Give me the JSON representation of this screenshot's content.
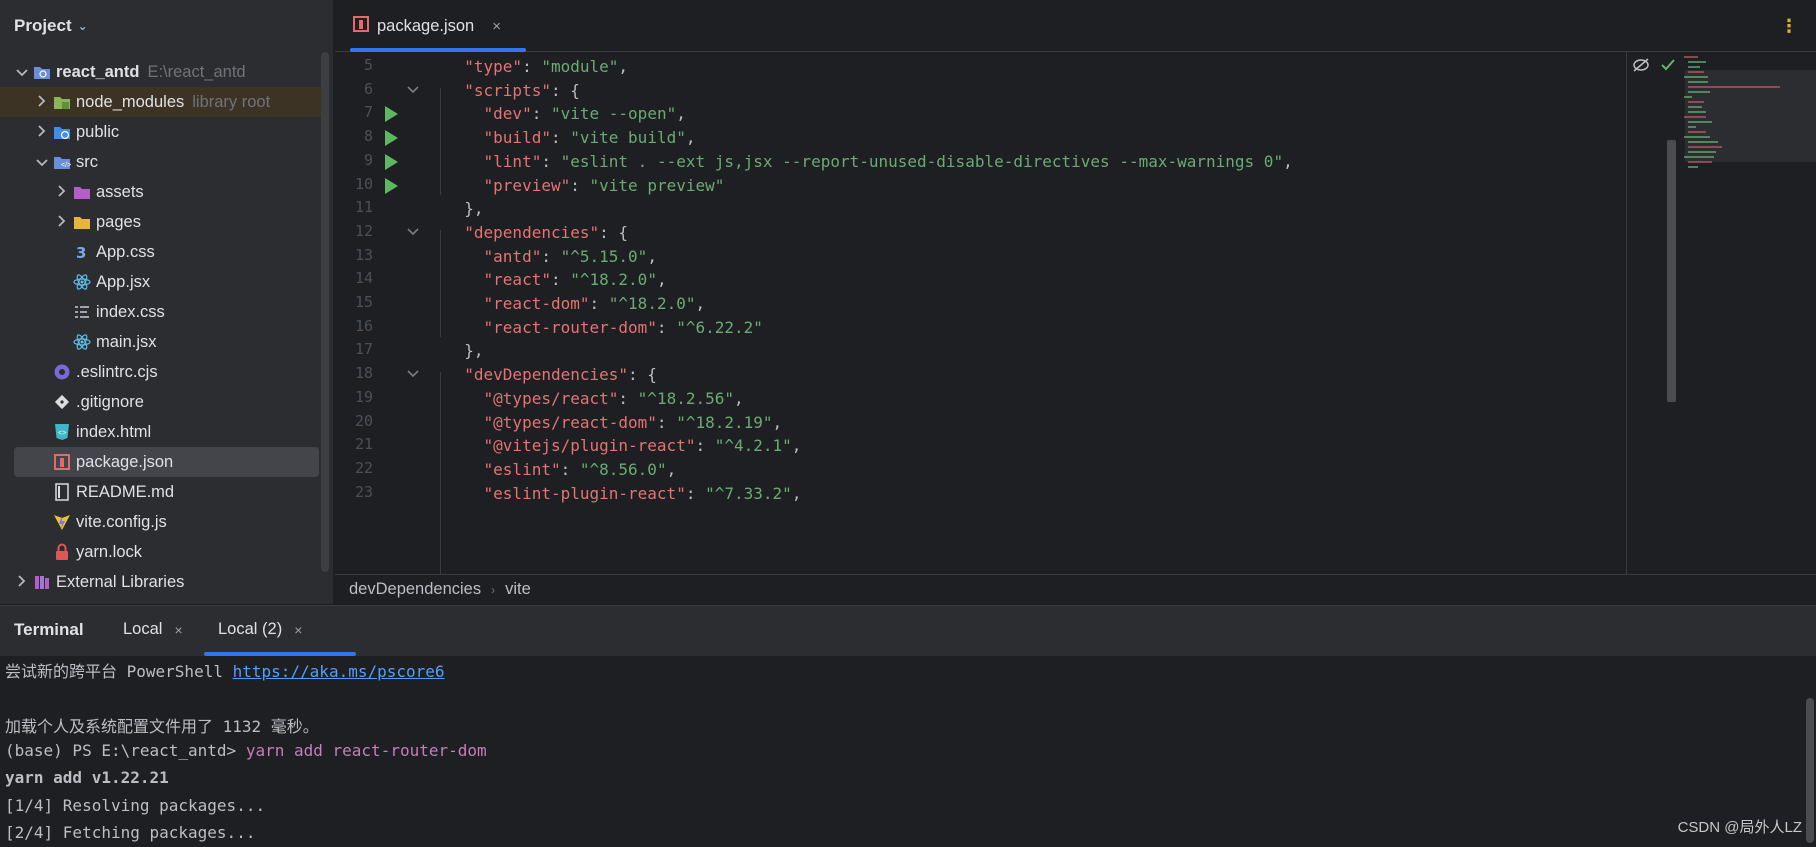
{
  "sidebar": {
    "title": "Project",
    "rows": [
      {
        "name": "react_antd",
        "hint": "E:\\react_antd",
        "arrow": "down",
        "icon": "project-module-icon",
        "depth": 0,
        "bold": true
      },
      {
        "name": "node_modules",
        "hint": "library root",
        "arrow": "right",
        "icon": "folder-node-icon",
        "depth": 1,
        "highlight": true
      },
      {
        "name": "public",
        "hint": "",
        "arrow": "right",
        "icon": "folder-web-icon",
        "depth": 1
      },
      {
        "name": "src",
        "hint": "",
        "arrow": "down",
        "icon": "folder-source-icon",
        "depth": 1
      },
      {
        "name": "assets",
        "hint": "",
        "arrow": "right",
        "icon": "folder-resources-icon",
        "depth": 2
      },
      {
        "name": "pages",
        "hint": "",
        "arrow": "right",
        "icon": "folder-icon",
        "depth": 2
      },
      {
        "name": "App.css",
        "hint": "",
        "arrow": "",
        "icon": "css-file-icon",
        "depth": 2
      },
      {
        "name": "App.jsx",
        "hint": "",
        "arrow": "",
        "icon": "react-file-icon",
        "depth": 2
      },
      {
        "name": "index.css",
        "hint": "",
        "arrow": "",
        "icon": "stylesheet-file-icon",
        "depth": 2
      },
      {
        "name": "main.jsx",
        "hint": "",
        "arrow": "",
        "icon": "react-file-icon",
        "depth": 2
      },
      {
        "name": ".eslintrc.cjs",
        "hint": "",
        "arrow": "",
        "icon": "eslint-file-icon",
        "depth": 1
      },
      {
        "name": ".gitignore",
        "hint": "",
        "arrow": "",
        "icon": "git-file-icon",
        "depth": 1
      },
      {
        "name": "index.html",
        "hint": "",
        "arrow": "",
        "icon": "html-file-icon",
        "depth": 1
      },
      {
        "name": "package.json",
        "hint": "",
        "arrow": "",
        "icon": "npm-file-icon",
        "depth": 1,
        "selected": true
      },
      {
        "name": "README.md",
        "hint": "",
        "arrow": "",
        "icon": "markdown-file-icon",
        "depth": 1
      },
      {
        "name": "vite.config.js",
        "hint": "",
        "arrow": "",
        "icon": "vite-file-icon",
        "depth": 1
      },
      {
        "name": "yarn.lock",
        "hint": "",
        "arrow": "",
        "icon": "lock-file-icon",
        "depth": 1
      },
      {
        "name": "External Libraries",
        "hint": "",
        "arrow": "right",
        "icon": "external-libraries-icon",
        "depth": 0
      }
    ]
  },
  "editor": {
    "tab_label": "package.json",
    "tab_close": "×",
    "menu_glyph": "⋮",
    "lines": [
      {
        "n": "5",
        "text": "  \"type\": \"module\",",
        "fold": false,
        "run": false
      },
      {
        "n": "6",
        "text": "  \"scripts\": {",
        "fold": true,
        "run": false
      },
      {
        "n": "7",
        "text": "    \"dev\": \"vite --open\",",
        "fold": false,
        "run": true
      },
      {
        "n": "8",
        "text": "    \"build\": \"vite build\",",
        "fold": false,
        "run": true
      },
      {
        "n": "9",
        "text": "    \"lint\": \"eslint . --ext js,jsx --report-unused-disable-directives --max-warnings 0\",",
        "fold": false,
        "run": true
      },
      {
        "n": "10",
        "text": "    \"preview\": \"vite preview\"",
        "fold": false,
        "run": true
      },
      {
        "n": "11",
        "text": "  },",
        "fold": false,
        "run": false
      },
      {
        "n": "12",
        "text": "  \"dependencies\": {",
        "fold": true,
        "run": false
      },
      {
        "n": "13",
        "text": "    \"antd\": \"^5.15.0\",",
        "fold": false,
        "run": false
      },
      {
        "n": "14",
        "text": "    \"react\": \"^18.2.0\",",
        "fold": false,
        "run": false
      },
      {
        "n": "15",
        "text": "    \"react-dom\": \"^18.2.0\",",
        "fold": false,
        "run": false
      },
      {
        "n": "16",
        "text": "    \"react-router-dom\": \"^6.22.2\"",
        "fold": false,
        "run": false
      },
      {
        "n": "17",
        "text": "  },",
        "fold": false,
        "run": false
      },
      {
        "n": "18",
        "text": "  \"devDependencies\": {",
        "fold": true,
        "run": false
      },
      {
        "n": "19",
        "text": "    \"@types/react\": \"^18.2.56\",",
        "fold": false,
        "run": false
      },
      {
        "n": "20",
        "text": "    \"@types/react-dom\": \"^18.2.19\",",
        "fold": false,
        "run": false
      },
      {
        "n": "21",
        "text": "    \"@vitejs/plugin-react\": \"^4.2.1\",",
        "fold": false,
        "run": false
      },
      {
        "n": "22",
        "text": "    \"eslint\": \"^8.56.0\",",
        "fold": false,
        "run": false
      },
      {
        "n": "23",
        "text": "    \"eslint-plugin-react\": \"^7.33.2\",",
        "fold": false,
        "run": false
      }
    ],
    "breadcrumb": [
      "devDependencies",
      "vite"
    ],
    "colors": {
      "key": "#e57373",
      "string": "#6aab73",
      "punct": "#bcbec4",
      "run": "#5fb85f",
      "accent": "#3574f0"
    }
  },
  "terminal": {
    "title": "Terminal",
    "tabs": [
      {
        "label": "Local",
        "close": "×"
      },
      {
        "label": "Local (2)",
        "close": "×",
        "active": true
      }
    ],
    "lines": {
      "l1_text": "尝试新的跨平台 PowerShell ",
      "l1_link": "https://aka.ms/pscore6",
      "l2": "",
      "l3": "加载个人及系统配置文件用了 1132 毫秒。",
      "l4_prompt": "(base) PS E:\\react_antd> ",
      "l4_cmd": "yarn add react-router-dom",
      "l5": "yarn add v1.22.21",
      "l6": "[1/4] Resolving packages...",
      "l7": "[2/4] Fetching packages..."
    },
    "watermark": "CSDN @局外人LZ"
  }
}
